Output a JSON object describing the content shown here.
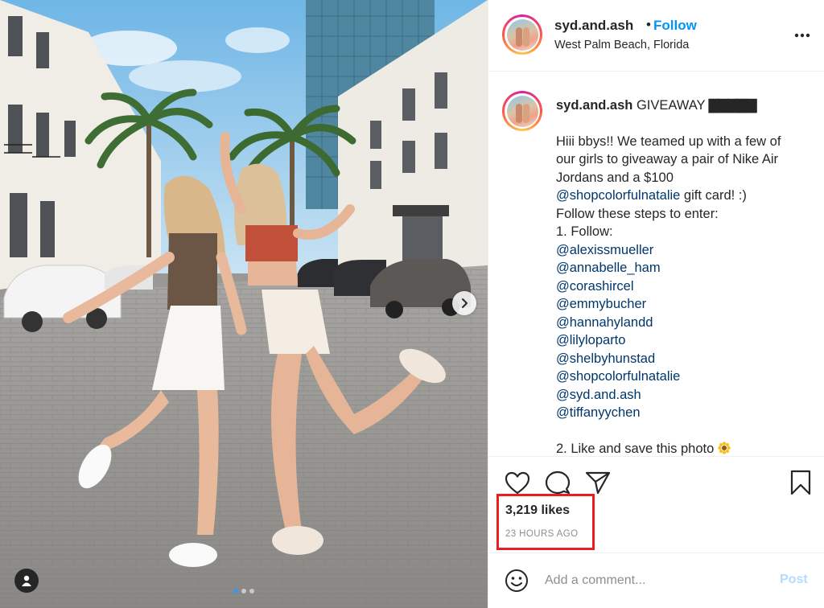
{
  "post": {
    "username": "syd.and.ash",
    "bullet": "•",
    "follow_label": "Follow",
    "location": "West Palm Beach, Florida"
  },
  "caption": {
    "username": "syd.and.ash",
    "title_word": "GIVEAWAY",
    "title_blocks": "▇▇▇▇▇",
    "intro_lines": [
      "Hiii bbys!! We teamed up with a few of",
      "our girls to giveaway a pair of Nike Air",
      "Jordans and a $100"
    ],
    "intro_mention": "@shopcolorfulnatalie",
    "intro_tail": " gift card! :)",
    "steps_heading": "Follow these steps to enter:",
    "step1": "1. Follow:",
    "mentions": [
      "@alexissmueller",
      "@annabelle_ham",
      "@corashircel",
      "@emmybucher",
      "@hannahylandd",
      "@lilyloparto",
      "@shelbyhunstad",
      "@shopcolorfulnatalie",
      "@syd.and.ash",
      "@tiffanyychen"
    ],
    "step2": "2. Like and save this photo"
  },
  "engagement": {
    "likes": "3,219 likes",
    "time_ago": "23 HOURS AGO"
  },
  "comment": {
    "placeholder": "Add a comment...",
    "post_label": "Post"
  },
  "colors": {
    "accent": "#0095f6",
    "mention": "#00376b",
    "highlight_box": "#ee1c1c",
    "post_disabled": "#b3dbff"
  },
  "carousel": {
    "total_slides": 3,
    "active_slide": 1
  },
  "icons": [
    "more-options-icon",
    "heart-icon",
    "comment-icon",
    "share-icon",
    "bookmark-icon",
    "emoji-icon",
    "user-tag-icon",
    "next-arrow-icon"
  ]
}
